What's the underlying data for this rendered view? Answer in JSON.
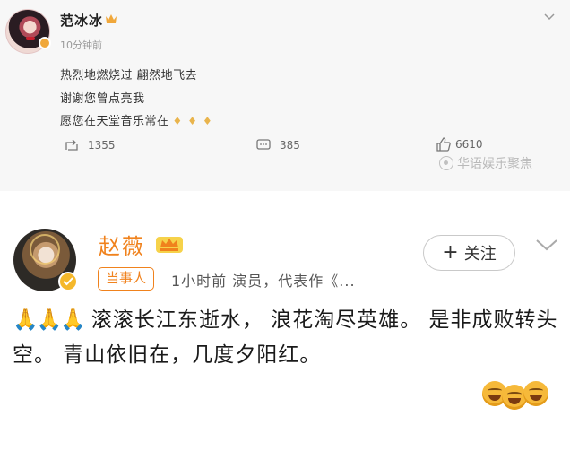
{
  "post1": {
    "author": "范冰冰",
    "time": "10分钟前",
    "lines": [
      "热烈地燃烧过 翩然地飞去",
      "谢谢您曾点亮我",
      "愿您在天堂音乐常在"
    ],
    "reposts": "1355",
    "comments": "385",
    "likes": "6610",
    "watermark": "华语娱乐聚焦"
  },
  "post2": {
    "author": "赵薇",
    "tag": "当事人",
    "meta": "1小时前  演员，代表作《...",
    "follow_label": "关注",
    "text": "滚滚长江东逝水， 浪花淘尽英雄。 是非成败转头空。 青山依旧在，几度夕阳红。"
  },
  "colors": {
    "accent": "#f0821d",
    "gold": "#f5b82b"
  }
}
